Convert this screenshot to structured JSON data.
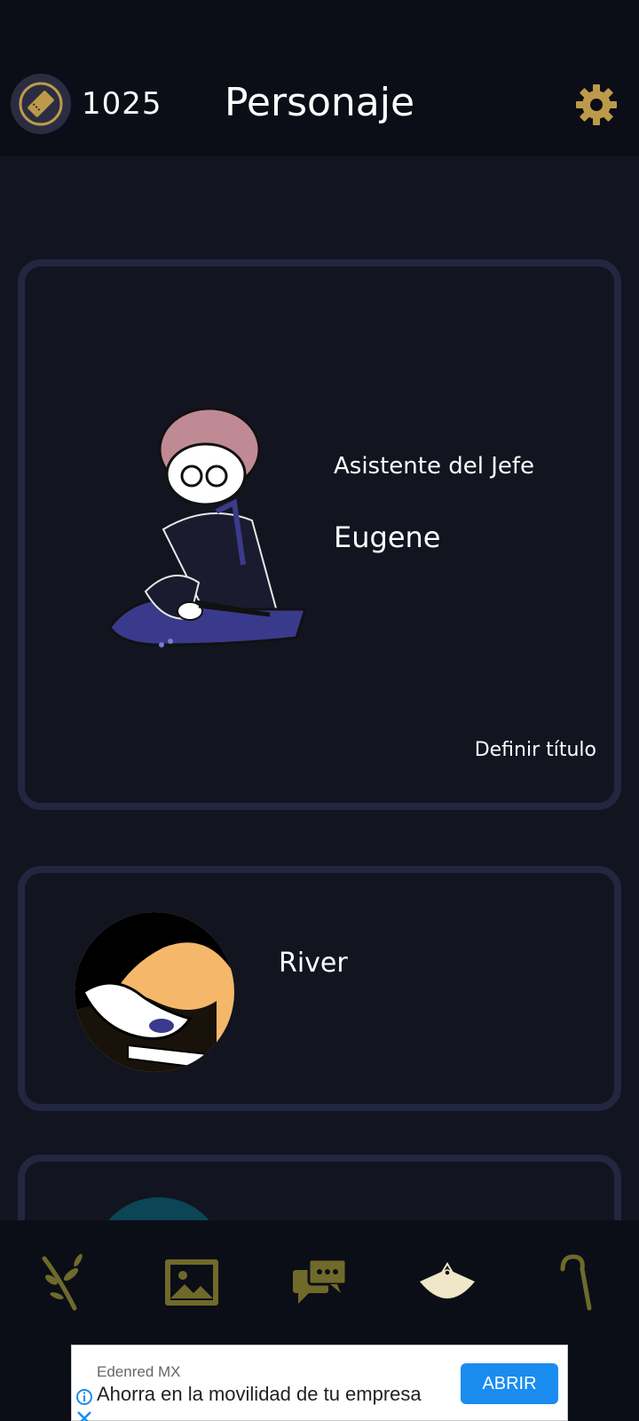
{
  "header": {
    "coins": "1025",
    "title": "Personaje",
    "coin_icon": "ticket-icon",
    "settings_icon": "gear-icon"
  },
  "characters": [
    {
      "title": "Asistente del Jefe",
      "name": "Eugene",
      "set_title_label": "Definir título"
    },
    {
      "name": "River"
    }
  ],
  "nav": {
    "items": [
      "branch-icon",
      "image-icon",
      "chat-icon",
      "fan-icon",
      "cane-icon"
    ]
  },
  "ad": {
    "advertiser": "Edenred MX",
    "headline": "Ahorra en la movilidad de tu empresa",
    "cta": "ABRIR"
  },
  "colors": {
    "background": "#121420",
    "bar": "#0b0e17",
    "card_border": "#232640",
    "accent_gold": "#bd9a4a",
    "ad_button": "#1a8cf0"
  }
}
